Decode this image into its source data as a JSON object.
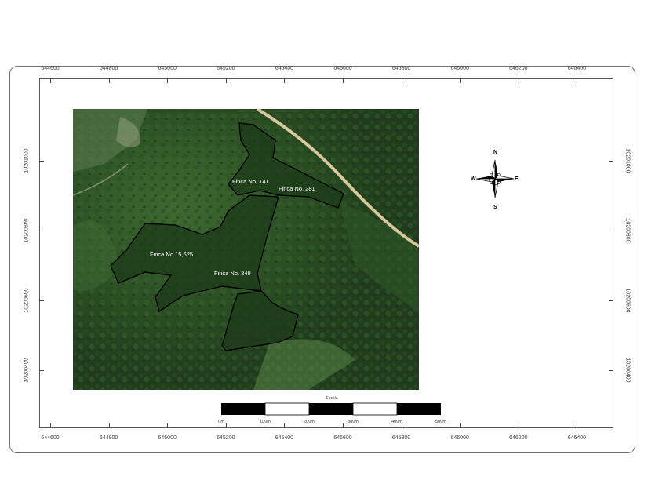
{
  "map": {
    "x_coords": [
      "644600",
      "644800",
      "645000",
      "645200",
      "645400",
      "645600",
      "645800",
      "646000",
      "646200",
      "646400"
    ],
    "y_coords": [
      "10201000",
      "10200800",
      "10200600",
      "10200400"
    ],
    "parcels": [
      {
        "label": "Finca No. 141"
      },
      {
        "label": "Finca No. 281"
      },
      {
        "label": "Finca No.15,625"
      },
      {
        "label": "Finca No. 349"
      }
    ],
    "compass": {
      "n": "N",
      "s": "S",
      "e": "E",
      "w": "W"
    },
    "scale": {
      "title": "Escala",
      "labels": [
        "0m",
        "100m",
        "200m",
        "300m",
        "400m",
        "500m"
      ]
    }
  }
}
